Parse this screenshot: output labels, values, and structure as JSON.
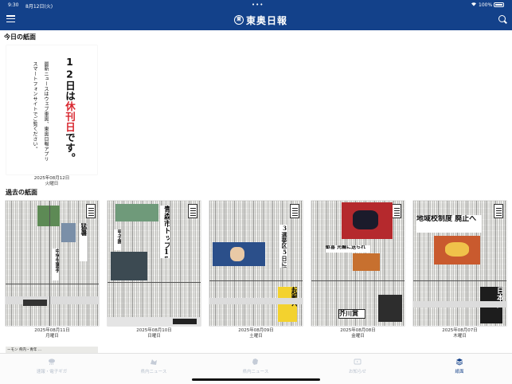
{
  "status_bar": {
    "time": "9:30",
    "date": "8月12日(火)",
    "battery_text": "100%"
  },
  "app": {
    "logo_mark": "東",
    "logo_text": "東奥日報",
    "brand_color": "#13418a",
    "accent_red": "#d8262e"
  },
  "today": {
    "section_title": "今日の紙面",
    "notice_big_part1": "12日は",
    "notice_big_red": "休刊日",
    "notice_big_part2": "です。",
    "notice_small_line1": "最新ニュースはウェブ東奥、東奥日報アプリ",
    "notice_small_line2": "スマートフォンサイトでご覧ください。",
    "date": "2025年08月12日",
    "weekday": "火曜日"
  },
  "past": {
    "section_title": "過去の紙面",
    "papers": [
      {
        "date": "2025年08月11日",
        "weekday": "月曜日",
        "headline1": "猛暑",
        "headline2": "中学生選手",
        "photo_color": "#5d8a55"
      },
      {
        "date": "2025年08月10日",
        "weekday": "日曜日",
        "headline1": "青森市トップ15億円",
        "headline2": "甲子園",
        "photo_color": "#6f9a7a"
      },
      {
        "date": "2025年08月09日",
        "weekday": "土曜日",
        "headline1": "3選挙区5日に選挙",
        "headline2": "起動へ",
        "photo_color": "#2b4f8a"
      },
      {
        "date": "2025年08月08日",
        "weekday": "金曜日",
        "headline1": "歓喜 光輪に送られ",
        "headline2": "芥川賞",
        "photo_color": "#b5292d"
      },
      {
        "date": "2025年08月07日",
        "weekday": "木曜日",
        "headline1": "地域校制度 廃止へ",
        "headline2": "日本人",
        "photo_color": "#c95a2e"
      }
    ],
    "partial_caption": "ーモン 県内・青年 ..."
  },
  "tabs": [
    {
      "label": "速報・電子ギガ",
      "icon": "rain-cloud-icon"
    },
    {
      "label": "県内ニュース",
      "icon": "map-icon"
    },
    {
      "label": "県内ニュース",
      "icon": "region-map-icon"
    },
    {
      "label": "お知らせ",
      "icon": "info-icon"
    },
    {
      "label": "紙面",
      "icon": "newspaper-icon",
      "active": true
    }
  ]
}
